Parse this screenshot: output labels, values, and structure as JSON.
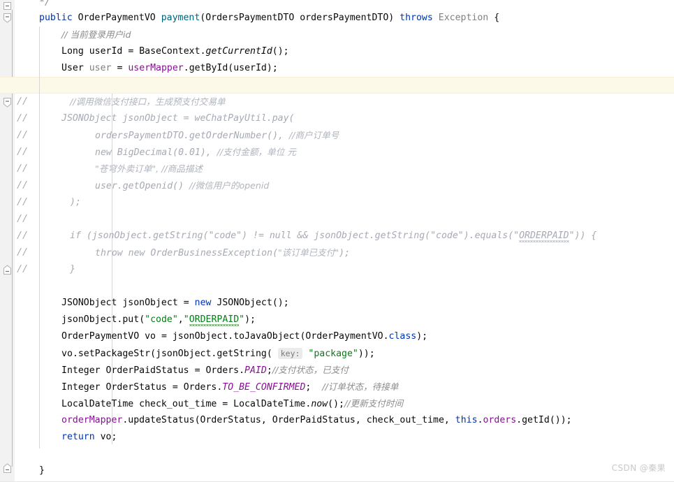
{
  "editor": {
    "language": "java",
    "font_size_px": 13,
    "line_height_px": 24,
    "caret_line_color": "#fdf9e8",
    "gutter_color": "#f2f2f2",
    "background": "#ffffff"
  },
  "watermark": {
    "text": "CSDN @秦果"
  },
  "palette": {
    "keyword": "#0033b3",
    "string": "#067d17",
    "number": "#1750eb",
    "field": "#871094",
    "static_field": "#871094",
    "method_decl": "#00627a",
    "comment": "#8c8c8c",
    "disabled_code": "#a6aab4",
    "text": "#080808",
    "typo_squiggle": "#5a9e5a",
    "hint_chip_bg": "#ebebeb"
  },
  "fold_markers": [
    {
      "line": 0,
      "type": "collapse",
      "shape": "square"
    },
    {
      "line": 1,
      "type": "collapse",
      "shape": "pennant"
    },
    {
      "line": 6,
      "type": "collapse",
      "shape": "pennant"
    },
    {
      "line": 16,
      "type": "collapse",
      "shape": "pennant-end"
    },
    {
      "line": 27,
      "type": "collapse",
      "shape": "pennant-end"
    }
  ],
  "comment_markers": {
    "label": "//",
    "lines": [
      6,
      7,
      8,
      9,
      10,
      11,
      12,
      13,
      14,
      15,
      16
    ]
  },
  "lines": [
    {
      "n": 0,
      "indent": 0,
      "text": "*/"
    },
    {
      "n": 1,
      "indent": 0,
      "text": "public OrderPaymentVO payment(OrdersPaymentDTO ordersPaymentDTO) throws Exception {"
    },
    {
      "n": 2,
      "indent": 1,
      "text": "// 当前登录用户id"
    },
    {
      "n": 3,
      "indent": 1,
      "text": "Long userId = BaseContext.getCurrentId();"
    },
    {
      "n": 4,
      "indent": 1,
      "text": "User user = userMapper.getById(userId);"
    },
    {
      "n": 5,
      "indent": 0,
      "text": "",
      "caret": true
    },
    {
      "n": 6,
      "indent": 1,
      "disabled": true,
      "text": "//调用微信支付接口，生成预支付交易单"
    },
    {
      "n": 7,
      "indent": 1,
      "disabled": true,
      "text": "JSONObject jsonObject = weChatPayUtil.pay("
    },
    {
      "n": 8,
      "indent": 2,
      "disabled": true,
      "text": "ordersPaymentDTO.getOrderNumber(), //商户订单号"
    },
    {
      "n": 9,
      "indent": 2,
      "disabled": true,
      "text": "new BigDecimal(0.01), //支付金额，单位 元"
    },
    {
      "n": 10,
      "indent": 2,
      "disabled": true,
      "text": "\"苍穹外卖订单\", //商品描述"
    },
    {
      "n": 11,
      "indent": 2,
      "disabled": true,
      "text": "user.getOpenid() //微信用户的openid"
    },
    {
      "n": 12,
      "indent": 1,
      "disabled": true,
      "text": ");"
    },
    {
      "n": 13,
      "indent": 0,
      "disabled": true,
      "text": ""
    },
    {
      "n": 14,
      "indent": 1,
      "disabled": true,
      "text": "if (jsonObject.getString(\"code\") != null && jsonObject.getString(\"code\").equals(\"ORDERPAID\")) {"
    },
    {
      "n": 15,
      "indent": 2,
      "disabled": true,
      "text": "throw new OrderBusinessException(\"该订单已支付\");"
    },
    {
      "n": 16,
      "indent": 1,
      "disabled": true,
      "text": "}"
    },
    {
      "n": 17,
      "indent": 0,
      "text": ""
    },
    {
      "n": 18,
      "indent": 1,
      "text": "JSONObject jsonObject = new JSONObject();"
    },
    {
      "n": 19,
      "indent": 1,
      "text": "jsonObject.put(\"code\",\"ORDERPAID\");"
    },
    {
      "n": 20,
      "indent": 1,
      "text": "OrderPaymentVO vo = jsonObject.toJavaObject(OrderPaymentVO.class);"
    },
    {
      "n": 21,
      "indent": 1,
      "text": "vo.setPackageStr(jsonObject.getString( key: \"package\"));",
      "hint": "key:"
    },
    {
      "n": 22,
      "indent": 1,
      "text": "Integer OrderPaidStatus = Orders.PAID;//支付状态，已支付"
    },
    {
      "n": 23,
      "indent": 1,
      "text": "Integer OrderStatus = Orders.TO_BE_CONFIRMED;  //订单状态，待接单"
    },
    {
      "n": 24,
      "indent": 1,
      "text": "LocalDateTime check_out_time = LocalDateTime.now();//更新支付时间"
    },
    {
      "n": 25,
      "indent": 1,
      "text": "orderMapper.updateStatus(OrderStatus, OrderPaidStatus, check_out_time, this.orders.getId());"
    },
    {
      "n": 26,
      "indent": 1,
      "text": "return vo;"
    },
    {
      "n": 27,
      "indent": 0,
      "text": ""
    },
    {
      "n": 28,
      "indent": 0,
      "text": "}"
    }
  ],
  "tokens": {
    "line0": {
      "comment_close": "*/"
    },
    "line1": {
      "public": "public",
      "ret_type": "OrderPaymentVO",
      "method": "payment",
      "param_type": "OrdersPaymentDTO",
      "param_name": "ordersPaymentDTO",
      "throws": "throws",
      "exception": "Exception",
      "brace": "{"
    },
    "line2": {
      "comment": "// 当前登录用户id"
    },
    "line3": {
      "type": "Long",
      "var": "userId",
      "eq": "=",
      "cls": "BaseContext",
      "dot": ".",
      "call": "getCurrentId",
      "tail": "();"
    },
    "line4": {
      "type": "User",
      "var": "user",
      "eq": "=",
      "field": "userMapper",
      "dot": ".",
      "call": "getById",
      "arg": "userId",
      "tail": ");"
    },
    "line18": {
      "type": "JSONObject",
      "var": "jsonObject",
      "eq": "=",
      "new": "new",
      "ctor": "JSONObject",
      "tail": "();"
    },
    "line19": {
      "obj": "jsonObject",
      "call": "put",
      "s1": "\"code\"",
      "s2": "\"ORDERPAID\"",
      "tail": ");"
    },
    "line20": {
      "type": "OrderPaymentVO",
      "var": "vo",
      "obj": "jsonObject",
      "call": "toJavaObject",
      "arg_cls": "OrderPaymentVO",
      "class_kw": "class",
      "tail": ");"
    },
    "line21": {
      "obj": "vo",
      "call": "setPackageStr",
      "inner_obj": "jsonObject",
      "inner_call": "getString",
      "hint": "key:",
      "str": "\"package\"",
      "tail": "));"
    },
    "line22": {
      "type": "Integer",
      "var": "OrderPaidStatus",
      "cls": "Orders",
      "const": "PAID",
      "comment": "//支付状态，已支付"
    },
    "line23": {
      "type": "Integer",
      "var": "OrderStatus",
      "cls": "Orders",
      "const": "TO_BE_CONFIRMED",
      "comment": "//订单状态，待接单"
    },
    "line24": {
      "type": "LocalDateTime",
      "var": "check_out_time",
      "cls": "LocalDateTime",
      "call": "now",
      "comment": "//更新支付时间"
    },
    "line25": {
      "field": "orderMapper",
      "call": "updateStatus",
      "a1": "OrderStatus",
      "a2": "OrderPaidStatus",
      "a3": "check_out_time",
      "this": "this",
      "orders": "orders",
      "getid": "getId"
    },
    "line26": {
      "return": "return",
      "var": "vo"
    }
  }
}
